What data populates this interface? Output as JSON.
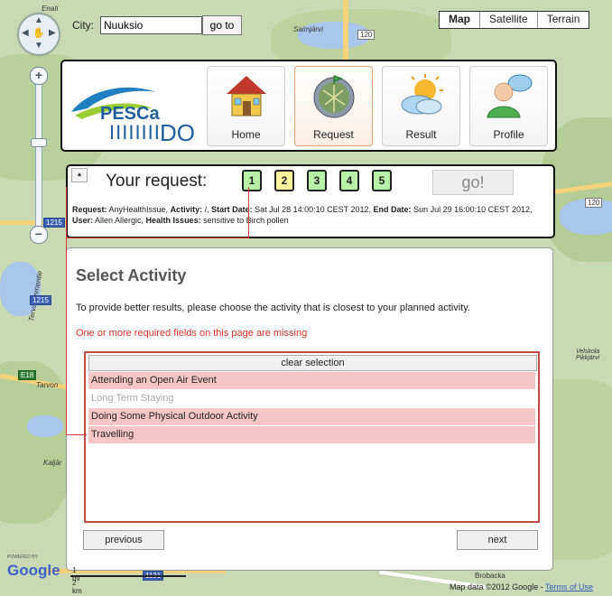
{
  "map": {
    "city_label": "City:",
    "city_value": "Nuuksio",
    "goto_label": "go to",
    "map_types": [
      "Map",
      "Satellite",
      "Terrain"
    ],
    "labels": [
      "Saimjärvi",
      "Velskola Pikkjärvi",
      "Kaljär",
      "Brobacka",
      "Tervalammentie",
      "Tarvon",
      "Enati"
    ],
    "road_numbers": [
      "120",
      "120",
      "1215",
      "1215",
      "E18",
      "1131"
    ],
    "scale": [
      "1 mi",
      "2 km"
    ],
    "footer": {
      "powered": "POWERED BY",
      "brand": "Google",
      "data": "Map data ©2012 Google",
      "sep": " - ",
      "terms": "Terms of Use"
    }
  },
  "header": {
    "logo_text": "PESCaDO",
    "nav": [
      {
        "label": "Home",
        "icon": "house-icon"
      },
      {
        "label": "Request",
        "icon": "map-globe-icon",
        "active": true
      },
      {
        "label": "Result",
        "icon": "weather-sun-cloud-icon"
      },
      {
        "label": "Profile",
        "icon": "user-speech-icon"
      }
    ]
  },
  "request": {
    "title": "Your request:",
    "steps": [
      {
        "label": "1",
        "color": "#b8f0a8"
      },
      {
        "label": "2",
        "color": "#fff3a0"
      },
      {
        "label": "3",
        "color": "#b8f0a8"
      },
      {
        "label": "4",
        "color": "#b8f0a8"
      },
      {
        "label": "5",
        "color": "#b8f0a8"
      }
    ],
    "go_label": "go!",
    "summary": {
      "request_key": "Request:",
      "request_val": " AnyHealthIssue, ",
      "activity_key": "Activity:",
      "activity_val": " /, ",
      "start_key": "Start Date:",
      "start_val": " Sat Jul 28 14:00:10 CEST 2012, ",
      "end_key": "End Date:",
      "end_val": " Sun Jul 29 16:00:10 CEST 2012, ",
      "user_key": "User:",
      "user_val": " Allen Allergic, ",
      "health_key": "Health Issues:",
      "health_val": " sensitive to Birch pollen"
    }
  },
  "activity": {
    "title": "Select Activity",
    "description": "To provide better results, please choose the activity that is closest to your planned activity.",
    "error": "One or more required fields on this page are missing",
    "clear_label": "clear selection",
    "items": [
      {
        "label": "Attending an Open Air Event",
        "state": "pink"
      },
      {
        "label": "Long Term Staying",
        "state": "gray"
      },
      {
        "label": "Doing Some Physical Outdoor Activity",
        "state": "pink"
      },
      {
        "label": "Travelling",
        "state": "pink"
      }
    ],
    "previous_label": "previous",
    "next_label": "next"
  }
}
